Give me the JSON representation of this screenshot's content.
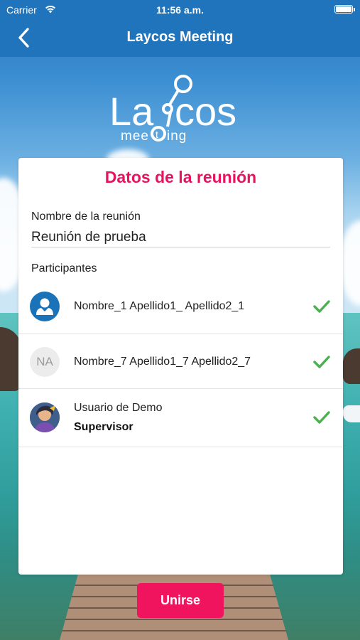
{
  "status_bar": {
    "carrier": "Carrier",
    "time": "11:56 a.m."
  },
  "nav": {
    "title": "Laycos Meeting"
  },
  "logo": {
    "wordmark": "Laycos",
    "subtitle": "meeting"
  },
  "card": {
    "heading": "Datos de la reunión",
    "meeting_name_label": "Nombre de la reunión",
    "meeting_name_value": "Reunión de prueba",
    "participants_label": "Participantes",
    "participants": [
      {
        "name": "Nombre_1 Apellido1_ Apellido2_1",
        "avatar": "person-icon",
        "confirmed": true
      },
      {
        "name": "Nombre_7 Apellido1_7 Apellido2_7",
        "avatar_initials": "NA",
        "confirmed": true
      },
      {
        "name": "Usuario de Demo",
        "role": "Supervisor",
        "avatar": "user-photo",
        "confirmed": true
      }
    ]
  },
  "join_button": {
    "label": "Unirse"
  },
  "colors": {
    "nav_bar": "#1f74bb",
    "accent": "#e8135f",
    "check": "#4caf50"
  }
}
